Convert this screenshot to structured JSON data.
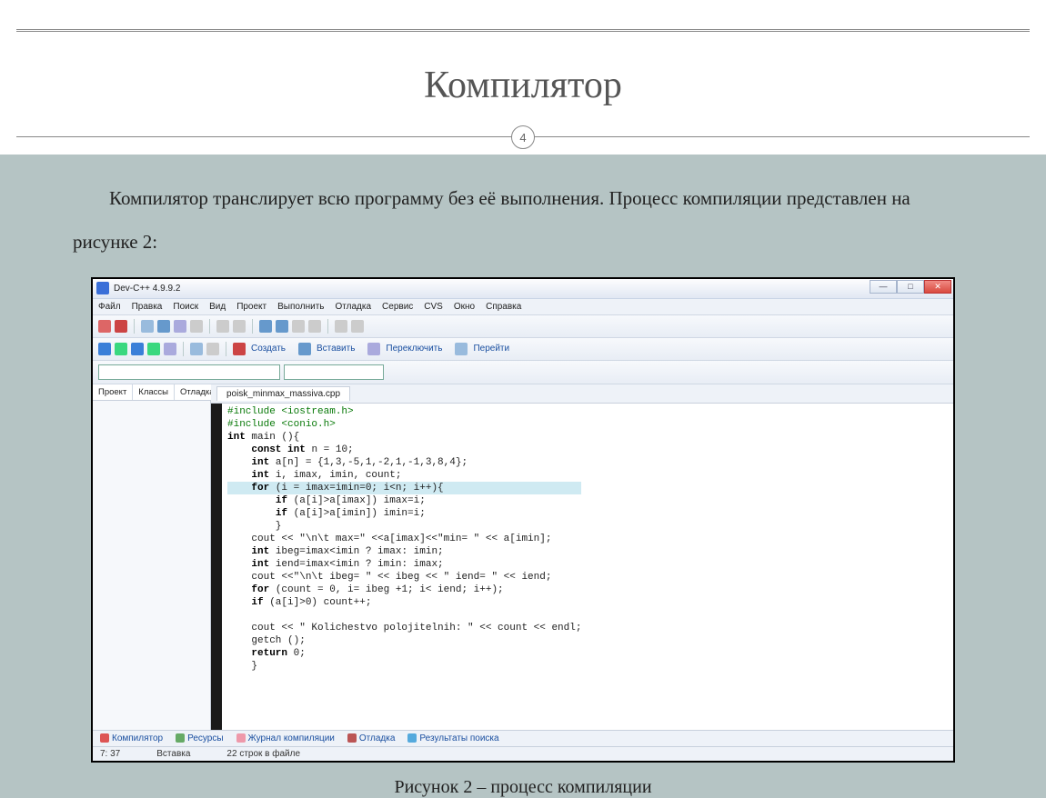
{
  "page_number": "4",
  "title": "Компилятор",
  "body_text": "Компилятор транслирует всю программу без её выполнения. Процесс компиляции представлен на рисунке 2:",
  "caption": "Рисунок 2 –  процесс компиляции",
  "devcpp": {
    "window_title": "Dev-C++ 4.9.9.2",
    "menu": [
      "Файл",
      "Правка",
      "Поиск",
      "Вид",
      "Проект",
      "Выполнить",
      "Отладка",
      "Сервис",
      "CVS",
      "Окно",
      "Справка"
    ],
    "toolbar_labels": {
      "create": "Создать",
      "insert": "Вставить",
      "toggle": "Переключить",
      "goto": "Перейти"
    },
    "side_tabs": [
      "Проект",
      "Классы",
      "Отладка"
    ],
    "file_tab": "poisk_minmax_massiva.cpp",
    "code_lines": [
      {
        "cls": "inc",
        "text": "#include <iostream.h>"
      },
      {
        "cls": "inc",
        "text": "#include <conio.h>"
      },
      {
        "cls": "",
        "text": "int main (){"
      },
      {
        "cls": "",
        "text": "    const int n = 10;"
      },
      {
        "cls": "",
        "text": "    int a[n] = {1,3,-5,1,-2,1,-1,3,8,4};"
      },
      {
        "cls": "",
        "text": "    int i, imax, imin, count;"
      },
      {
        "cls": "hl",
        "text": "    for (i = imax=imin=0; i<n; i++){"
      },
      {
        "cls": "",
        "text": "        if (a[i]>a[imax]) imax=i;"
      },
      {
        "cls": "",
        "text": "        if (a[i]>a[imin]) imin=i;"
      },
      {
        "cls": "",
        "text": "        }"
      },
      {
        "cls": "",
        "text": "    cout << \"\\n\\t max=\" <<a[imax]<<\"min= \" << a[imin];",
        "strparts": true
      },
      {
        "cls": "",
        "text": "    int ibeg=imax<imin ? imax: imin;"
      },
      {
        "cls": "",
        "text": "    int iend=imax<imin ? imin: imax;"
      },
      {
        "cls": "",
        "text": "    cout <<\"\\n\\t ibeg= \" << ibeg << \" iend= \" << iend;",
        "strparts": true
      },
      {
        "cls": "",
        "text": "    for (count = 0, i= ibeg +1; i< iend; i++);"
      },
      {
        "cls": "",
        "text": "    if (a[i]>0) count++;"
      },
      {
        "cls": "",
        "text": ""
      },
      {
        "cls": "",
        "text": "    cout << \" Kolichestvo polojitelnih: \" << count << endl;",
        "strparts": true
      },
      {
        "cls": "",
        "text": "    getch ();"
      },
      {
        "cls": "",
        "text": "    return 0;"
      },
      {
        "cls": "",
        "text": "    }"
      }
    ],
    "bottom_tabs": [
      "Компилятор",
      "Ресурсы",
      "Журнал компиляции",
      "Отладка",
      "Результаты поиска"
    ],
    "status": {
      "pos": "7: 37",
      "mode": "Вставка",
      "lines": "22 строк в файле"
    }
  }
}
